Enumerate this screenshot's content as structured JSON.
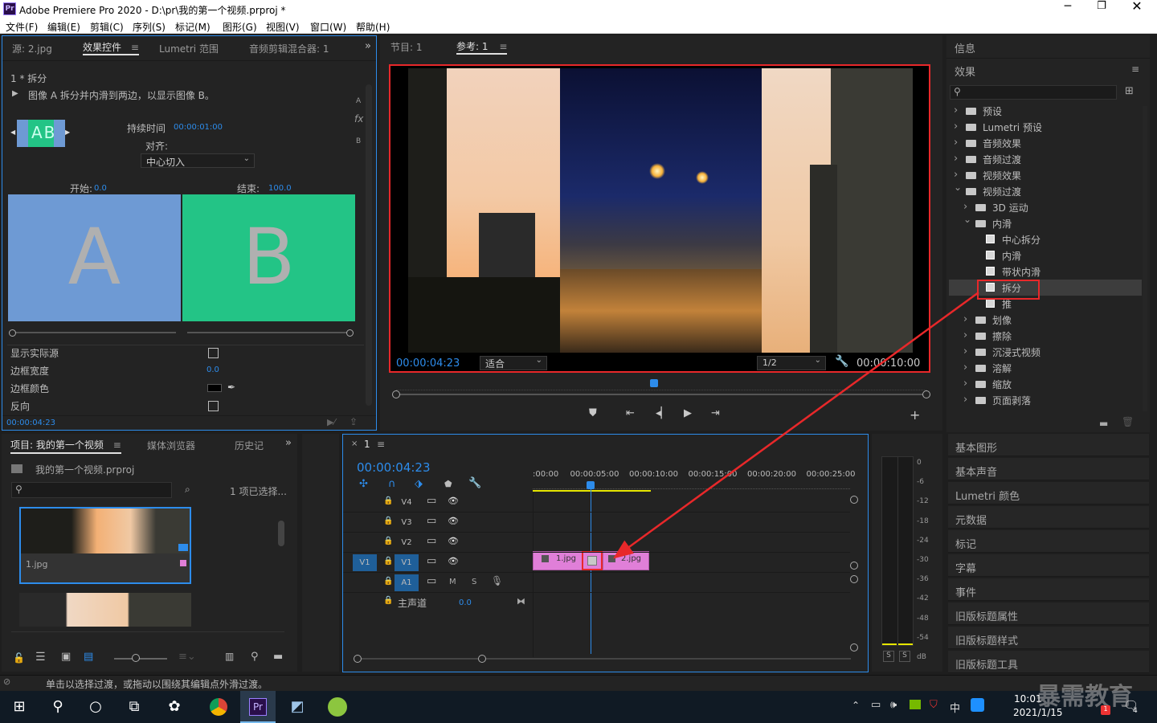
{
  "window": {
    "title": "Adobe Premiere Pro 2020 - D:\\pr\\我的第一个视频.prproj *",
    "logo": "Pr"
  },
  "menu": [
    "文件(F)",
    "编辑(E)",
    "剪辑(C)",
    "序列(S)",
    "标记(M)",
    "图形(G)",
    "视图(V)",
    "窗口(W)",
    "帮助(H)"
  ],
  "source_panel": {
    "tabs": [
      "源: 2.jpg",
      "效果控件",
      "Lumetri 范围",
      "音频剪辑混合器: 1"
    ],
    "clip_header": "1 * 拆分",
    "description": "图像 A 拆分并内滑到两边，以显示图像 B。",
    "duration_label": "持续时间",
    "duration_value": "00:00:01:00",
    "align_label": "对齐:",
    "align_value": "中心切入",
    "start_label": "开始:",
    "start_value": "0.0",
    "end_label": "结束:",
    "end_value": "100.0",
    "preview_a": "A",
    "preview_b": "B",
    "thumb_text": "AB",
    "side_a": "A",
    "side_b": "B",
    "fx": "fx",
    "props": [
      {
        "label": "显示实际源"
      },
      {
        "label": "边框宽度",
        "value": "0.0"
      },
      {
        "label": "边框颜色"
      },
      {
        "label": "反向"
      }
    ],
    "timecode": "00:00:04:23",
    "border_color": "#000000"
  },
  "program_monitor": {
    "tabs": [
      "节目: 1",
      "参考: 1"
    ],
    "timecode": "00:00:04:23",
    "fit": "适合",
    "quality": "1/2",
    "duration": "00:00:10:00"
  },
  "effects_panel": {
    "info_tab": "信息",
    "title": "效果",
    "items": [
      {
        "label": "预设",
        "level": 0,
        "kind": "folder",
        "open": false
      },
      {
        "label": "Lumetri 预设",
        "level": 0,
        "kind": "folder",
        "open": false
      },
      {
        "label": "音频效果",
        "level": 0,
        "kind": "folder",
        "open": false
      },
      {
        "label": "音频过渡",
        "level": 0,
        "kind": "folder",
        "open": false
      },
      {
        "label": "视频效果",
        "level": 0,
        "kind": "folder",
        "open": false
      },
      {
        "label": "视频过渡",
        "level": 0,
        "kind": "folder",
        "open": true
      },
      {
        "label": "3D 运动",
        "level": 1,
        "kind": "folder",
        "open": false
      },
      {
        "label": "内滑",
        "level": 1,
        "kind": "folder",
        "open": true
      },
      {
        "label": "中心拆分",
        "level": 2,
        "kind": "effect"
      },
      {
        "label": "内滑",
        "level": 2,
        "kind": "effect"
      },
      {
        "label": "带状内滑",
        "level": 2,
        "kind": "effect"
      },
      {
        "label": "拆分",
        "level": 2,
        "kind": "effect",
        "selected": true
      },
      {
        "label": "推",
        "level": 2,
        "kind": "effect"
      },
      {
        "label": "划像",
        "level": 1,
        "kind": "folder",
        "open": false
      },
      {
        "label": "擦除",
        "level": 1,
        "kind": "folder",
        "open": false
      },
      {
        "label": "沉浸式视频",
        "level": 1,
        "kind": "folder",
        "open": false
      },
      {
        "label": "溶解",
        "level": 1,
        "kind": "folder",
        "open": false
      },
      {
        "label": "缩放",
        "level": 1,
        "kind": "folder",
        "open": false
      },
      {
        "label": "页面剥落",
        "level": 1,
        "kind": "folder",
        "open": false
      }
    ]
  },
  "side_panels": [
    "基本图形",
    "基本声音",
    "Lumetri 颜色",
    "元数据",
    "标记",
    "字幕",
    "事件",
    "旧版标题属性",
    "旧版标题样式",
    "旧版标题工具"
  ],
  "project_panel": {
    "tabs": [
      "项目: 我的第一个视频",
      "媒体浏览器",
      "历史记"
    ],
    "file": "我的第一个视频.prproj",
    "selection": "1 项已选择...",
    "clip1": "1.jpg"
  },
  "timeline": {
    "tab": "1",
    "timecode": "00:00:04:23",
    "ruler": [
      ":00:00",
      "00:00:05:00",
      "00:00:10:00",
      "00:00:15:00",
      "00:00:20:00",
      "00:00:25:00"
    ],
    "tracks": [
      {
        "label": "V4"
      },
      {
        "label": "V3"
      },
      {
        "label": "V2"
      },
      {
        "label": "V1",
        "source": "V1"
      },
      {
        "label": "A1",
        "m": "M",
        "s": "S"
      }
    ],
    "master": "主声道",
    "master_value": "0.0",
    "clip1": "1.jpg",
    "clip2": "2.jpg"
  },
  "audio_meter": {
    "scale": [
      "0",
      "-6",
      "-12",
      "-18",
      "-24",
      "-30",
      "-36",
      "-42",
      "-48",
      "-54",
      "dB"
    ],
    "solo": [
      "S",
      "S"
    ]
  },
  "status_bar": {
    "text": "单击以选择过渡，或拖动以围绕其编辑点外滑过渡。"
  },
  "taskbar": {
    "time": "10:01",
    "date": "2021/1/15",
    "ime": "中",
    "watermark": "暴需教育",
    "notif": "1",
    "badge": "4"
  },
  "colors": {
    "accent_blue": "#2d8ceb",
    "highlight_red": "#e8282a",
    "clip_pink": "#e07fd8",
    "preview_a_bg": "#6e9ad4",
    "preview_b_bg": "#23c486"
  }
}
